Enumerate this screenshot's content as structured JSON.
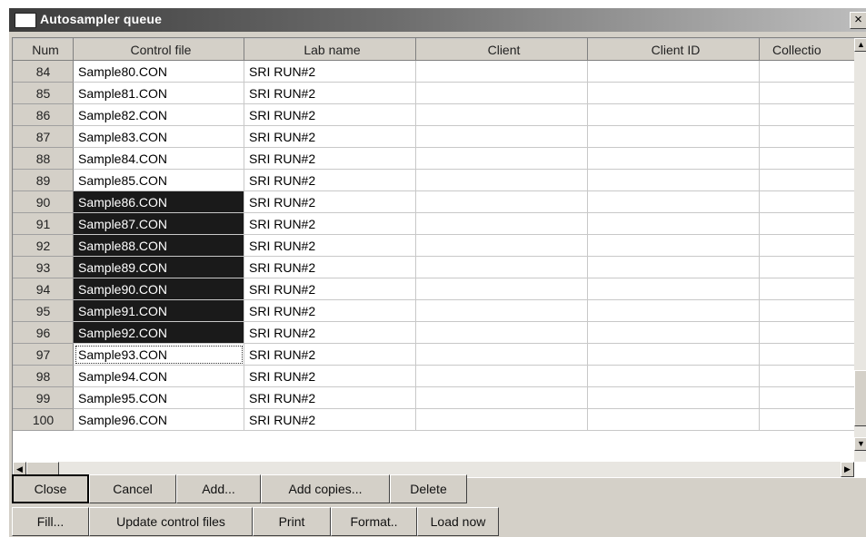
{
  "window": {
    "title": "Autosampler queue",
    "close_label": "×"
  },
  "grid": {
    "columns": [
      "Num",
      "Control file",
      "Lab name",
      "Client",
      "Client ID",
      "Collectio"
    ],
    "rows": [
      {
        "num": "84",
        "control_file": "Sample80.CON",
        "lab_name": "SRI RUN#2",
        "client": "",
        "client_id": "",
        "collection": ""
      },
      {
        "num": "85",
        "control_file": "Sample81.CON",
        "lab_name": "SRI RUN#2",
        "client": "",
        "client_id": "",
        "collection": ""
      },
      {
        "num": "86",
        "control_file": "Sample82.CON",
        "lab_name": "SRI RUN#2",
        "client": "",
        "client_id": "",
        "collection": ""
      },
      {
        "num": "87",
        "control_file": "Sample83.CON",
        "lab_name": "SRI RUN#2",
        "client": "",
        "client_id": "",
        "collection": ""
      },
      {
        "num": "88",
        "control_file": "Sample84.CON",
        "lab_name": "SRI RUN#2",
        "client": "",
        "client_id": "",
        "collection": ""
      },
      {
        "num": "89",
        "control_file": "Sample85.CON",
        "lab_name": "SRI RUN#2",
        "client": "",
        "client_id": "",
        "collection": ""
      },
      {
        "num": "90",
        "control_file": "Sample86.CON",
        "lab_name": "SRI RUN#2",
        "client": "",
        "client_id": "",
        "collection": ""
      },
      {
        "num": "91",
        "control_file": "Sample87.CON",
        "lab_name": "SRI RUN#2",
        "client": "",
        "client_id": "",
        "collection": ""
      },
      {
        "num": "92",
        "control_file": "Sample88.CON",
        "lab_name": "SRI RUN#2",
        "client": "",
        "client_id": "",
        "collection": ""
      },
      {
        "num": "93",
        "control_file": "Sample89.CON",
        "lab_name": "SRI RUN#2",
        "client": "",
        "client_id": "",
        "collection": ""
      },
      {
        "num": "94",
        "control_file": "Sample90.CON",
        "lab_name": "SRI RUN#2",
        "client": "",
        "client_id": "",
        "collection": ""
      },
      {
        "num": "95",
        "control_file": "Sample91.CON",
        "lab_name": "SRI RUN#2",
        "client": "",
        "client_id": "",
        "collection": ""
      },
      {
        "num": "96",
        "control_file": "Sample92.CON",
        "lab_name": "SRI RUN#2",
        "client": "",
        "client_id": "",
        "collection": ""
      },
      {
        "num": "97",
        "control_file": "Sample93.CON",
        "lab_name": "SRI RUN#2",
        "client": "",
        "client_id": "",
        "collection": ""
      },
      {
        "num": "98",
        "control_file": "Sample94.CON",
        "lab_name": "SRI RUN#2",
        "client": "",
        "client_id": "",
        "collection": ""
      },
      {
        "num": "99",
        "control_file": "Sample95.CON",
        "lab_name": "SRI RUN#2",
        "client": "",
        "client_id": "",
        "collection": ""
      },
      {
        "num": "100",
        "control_file": "Sample96.CON",
        "lab_name": "SRI RUN#2",
        "client": "",
        "client_id": "",
        "collection": ""
      }
    ],
    "selected_rows": [
      "90",
      "91",
      "92",
      "93",
      "94",
      "95",
      "96"
    ],
    "focused_row": "97"
  },
  "scrollbars": {
    "up_arrow": "▲",
    "down_arrow": "▼",
    "left_arrow": "◀",
    "right_arrow": "▶"
  },
  "buttons": {
    "close": "Close",
    "cancel": "Cancel",
    "add": "Add...",
    "add_copies": "Add copies...",
    "delete": "Delete",
    "fill": "Fill...",
    "update_control_files": "Update control files",
    "print": "Print",
    "format": "Format..",
    "load_now": "Load now"
  }
}
